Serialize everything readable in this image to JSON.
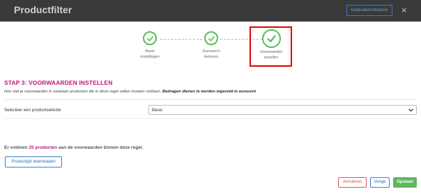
{
  "window": {
    "title": "Productfilter",
    "history_button": "Gebruikershistorie",
    "close_glyph": "×"
  },
  "wizard": {
    "steps": [
      {
        "line1": "Basis",
        "line2": "instellingen",
        "status": "completed",
        "icon": "check-icon"
      },
      {
        "line1": "Scenario's",
        "line2": "beheren",
        "status": "completed",
        "icon": "check-icon"
      },
      {
        "line1": "Voorwaarden",
        "line2": "instellen",
        "status": "active",
        "icon": "check-icon"
      }
    ]
  },
  "section": {
    "heading": "STAP 3: VOORWAARDEN INSTELLEN",
    "intro_text": "Hier stel je voorwaarden in waaraan producten die in deze regel vallen moeten voldoen. ",
    "intro_bold": "Bedragen dienen te worden ingevuld in eurocent",
    "select_label": "Selecteer een productselectie",
    "select_value": "Basis"
  },
  "result": {
    "prefix": "Er voldoen ",
    "count": "25 producten",
    "suffix": " aan de voorwaarden binnen deze regel."
  },
  "buttons": {
    "download": "Productlijst downloaden",
    "cancel": "Annuleren",
    "previous": "Vorige",
    "save": "Opslaan"
  },
  "colors": {
    "accent": "#c0177a",
    "success": "#5cb85c",
    "danger": "#d9534f",
    "primary": "#2b6cb8",
    "highlight": "#e00000",
    "titlebar": "#3a3a3a"
  }
}
